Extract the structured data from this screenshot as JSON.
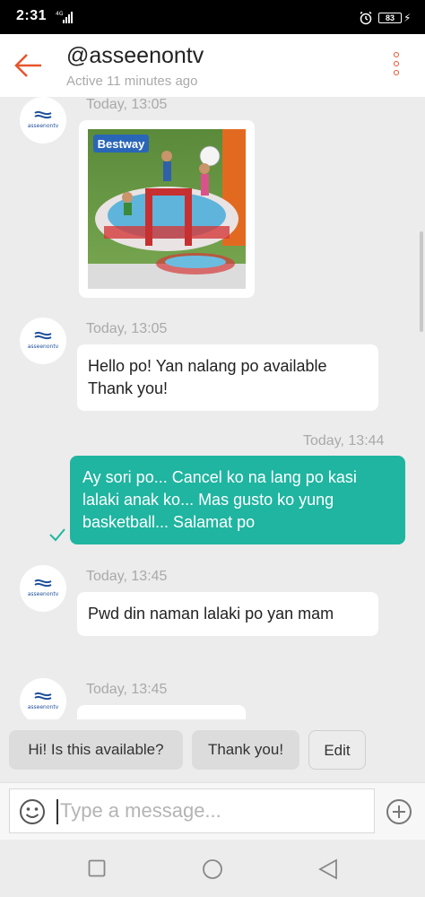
{
  "status_bar": {
    "time": "2:31",
    "network": "4G",
    "battery": "83",
    "icons": [
      "signal-icon",
      "alarm-icon",
      "battery-icon",
      "charging-icon"
    ]
  },
  "header": {
    "username": "@asseenontv",
    "status": "Active 11 minutes ago",
    "icons": [
      "back-arrow-icon",
      "more-vertical-icon"
    ],
    "accent_color": "#e8542c"
  },
  "avatar": {
    "brand_text": "asseenontv",
    "icon": "asseenontv-logo-icon"
  },
  "messages": [
    {
      "type": "image",
      "timestamp": "Today, 13:05",
      "image_text": "Bestway",
      "image_description_icon": "product-photo-pool-icon"
    },
    {
      "type": "text_in",
      "timestamp": "Today, 13:05",
      "text": "Hello po! Yan nalang po available Thank you!"
    },
    {
      "type": "text_out",
      "timestamp": "Today, 13:44",
      "text": "Ay sori po... Cancel ko na lang po kasi lalaki anak ko... Mas gusto ko yung basketball... Salamat po",
      "icon": "check-icon"
    },
    {
      "type": "text_in",
      "timestamp": "Today, 13:45",
      "text": "Pwd din naman lalaki po yan mam"
    },
    {
      "type": "text_in",
      "timestamp": "Today, 13:45",
      "text": ""
    }
  ],
  "colors": {
    "outgoing_bubble": "#1fb5a0",
    "incoming_bubble": "#ffffff",
    "chat_bg": "#ececec"
  },
  "quick_replies": [
    {
      "label": "Hi! Is this available?"
    },
    {
      "label": "Thank you!"
    },
    {
      "label": "Edit"
    }
  ],
  "composer": {
    "placeholder": "Type a message...",
    "icons": [
      "emoji-icon",
      "add-icon"
    ]
  },
  "nav_bar": {
    "icons": [
      "recents-icon",
      "home-icon",
      "back-icon"
    ]
  }
}
